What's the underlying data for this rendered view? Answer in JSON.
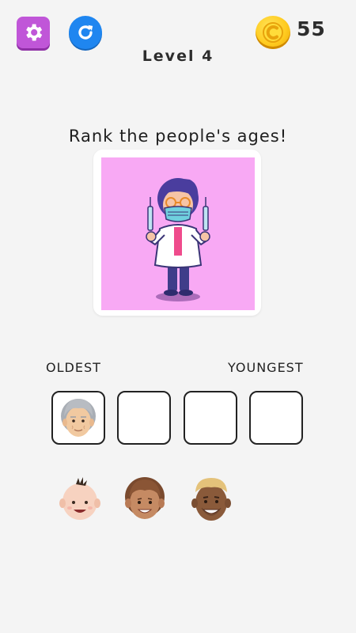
{
  "coins": "55",
  "level_title": "Level 4",
  "prompt": "Rank the people's ages!",
  "rank_labels": {
    "left": "OLDEST",
    "right": "YOUNGEST"
  },
  "slots": [
    "elderly-face",
    "",
    "",
    ""
  ],
  "choices": [
    "baby-face",
    "child-face",
    "adult-man-face"
  ],
  "colors": {
    "settings_button": "#c056d8",
    "refresh_button": "#1f86f0",
    "coin": "#ffcb1f",
    "picture_background": "#f8a9f4"
  },
  "icons": {
    "settings": "gear-icon",
    "refresh": "refresh-icon",
    "coin": "coin-icon"
  }
}
